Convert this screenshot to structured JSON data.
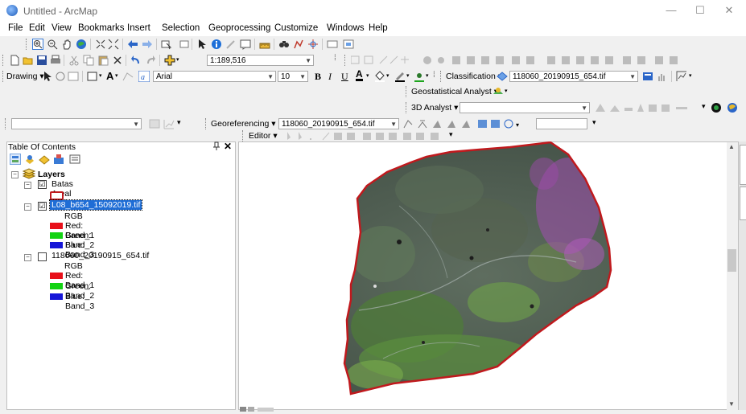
{
  "window": {
    "title": "Untitled - ArcMap",
    "minimize": "—",
    "maximize": "☐",
    "close": "✕"
  },
  "menu": [
    "File",
    "Edit",
    "View",
    "Bookmarks",
    "Insert",
    "Selection",
    "Geoprocessing",
    "Customize",
    "Windows",
    "Help"
  ],
  "toolbar": {
    "scale": "1:189,516",
    "drawing_label": "Drawing ▾",
    "font": "Arial",
    "font_size": "10",
    "bold": "B",
    "italic": "I",
    "underline": "U",
    "font_color": "A",
    "classification_label": "Classification ▾",
    "classification_layer": "118060_20190915_654.tif",
    "geostatistical": "Geostatistical Analyst ▾",
    "analyst3d": "3D Analyst ▾",
    "georeferencing": "Georeferencing ▾",
    "georef_layer": "118060_20190915_654.tif",
    "editor": "Editor ▾"
  },
  "toc": {
    "title": "Table Of Contents",
    "pin": "ᵖ",
    "close": "✕",
    "layers_group": "Layers",
    "items": [
      {
        "name": "Batas Areal Kerja",
        "checked": "☑"
      },
      {
        "name": "L08_b654_15092019.tif",
        "checked": "☑",
        "selected": true,
        "renderer": "RGB",
        "bands": [
          {
            "label": "Red:   Band_1",
            "color": "#e8101a"
          },
          {
            "label": "Green: Band_2",
            "color": "#12d312"
          },
          {
            "label": "Blue:  Band_3",
            "color": "#1515d8"
          }
        ]
      },
      {
        "name": "118060_20190915_654.tif",
        "checked": "☐",
        "renderer": "RGB",
        "bands": [
          {
            "label": "Red:   Band_1",
            "color": "#e8101a"
          },
          {
            "label": "Green: Band_2",
            "color": "#12d312"
          },
          {
            "label": "Blue:  Band_3",
            "color": "#1515d8"
          }
        ]
      }
    ]
  },
  "colors": {
    "boundary": "#c0191d",
    "selection": "#1e6dd6"
  }
}
